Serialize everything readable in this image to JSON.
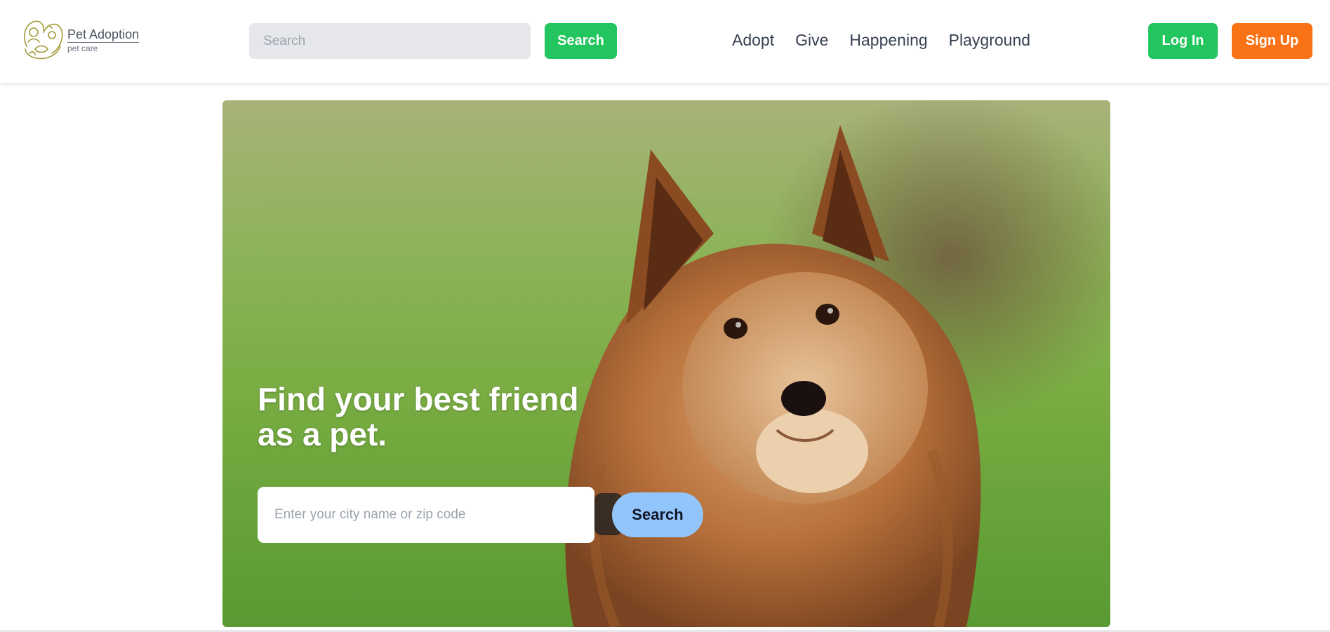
{
  "header": {
    "logo": {
      "title": "Pet Adoption",
      "subtitle": "pet care"
    },
    "search": {
      "placeholder": "Search",
      "value": "",
      "button_label": "Search"
    },
    "nav": [
      "Adopt",
      "Give",
      "Happening",
      "Playground"
    ],
    "login_label": "Log In",
    "signup_label": "Sign Up"
  },
  "hero": {
    "title_line1": "Find your best friend",
    "title_line2": "as a pet.",
    "input_placeholder": "Enter your city name or zip code",
    "input_value": "",
    "button_label": "Search"
  },
  "colors": {
    "primary_green": "#22c55e",
    "signup_orange": "#f97316",
    "hero_button_blue": "#93c5fd",
    "input_gray": "#e5e7eb",
    "nav_text": "#374151",
    "logo_olive": "#a39a3a"
  },
  "icons": {
    "logo": "pet-family-logo-icon"
  }
}
